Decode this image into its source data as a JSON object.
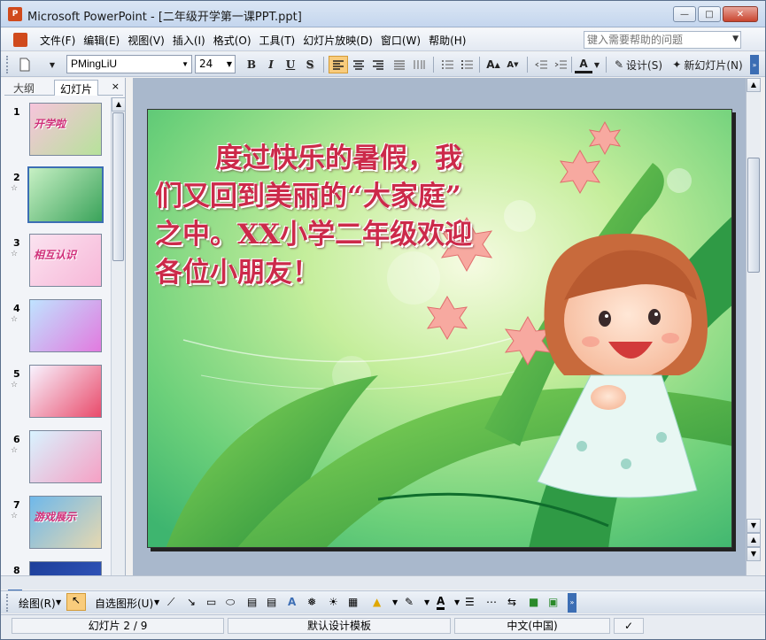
{
  "window": {
    "title": "Microsoft PowerPoint - [二年级开学第一课PPT.ppt]",
    "app_icon": "powerpoint-icon",
    "buttons": [
      "minimize",
      "maximize",
      "close"
    ]
  },
  "menubar": {
    "items": [
      "文件(F)",
      "编辑(E)",
      "视图(V)",
      "插入(I)",
      "格式(O)",
      "工具(T)",
      "幻灯片放映(D)",
      "窗口(W)",
      "帮助(H)"
    ],
    "help_placeholder": "键入需要帮助的问题"
  },
  "toolbar": {
    "font_name": "PMingLiU",
    "font_size": "24",
    "bold": "B",
    "italic": "I",
    "underline": "U",
    "shadow": "S",
    "design_label": "设计(S)",
    "new_slide_label": "新幻灯片(N)"
  },
  "panes": {
    "tab_outline": "大纲",
    "tab_slides": "幻灯片",
    "close_glyph": "×"
  },
  "thumbnails": [
    {
      "num": "1",
      "star": "",
      "colors": [
        "#f7c4dc",
        "#b6e29a"
      ],
      "caption": "开学啦"
    },
    {
      "num": "2",
      "star": "☆",
      "colors": [
        "#c7f0c4",
        "#3aa35a"
      ],
      "caption": ""
    },
    {
      "num": "3",
      "star": "☆",
      "colors": [
        "#fbe3f0",
        "#f7b7d8"
      ],
      "caption": "相互认识"
    },
    {
      "num": "4",
      "star": "☆",
      "colors": [
        "#bfe3ff",
        "#e27adf"
      ],
      "caption": ""
    },
    {
      "num": "5",
      "star": "☆",
      "colors": [
        "#f8f3ff",
        "#e94b6b"
      ],
      "caption": ""
    },
    {
      "num": "6",
      "star": "☆",
      "colors": [
        "#d8f3ff",
        "#f6a0c4"
      ],
      "caption": ""
    },
    {
      "num": "7",
      "star": "☆",
      "colors": [
        "#6fb8ea",
        "#e6d8b0"
      ],
      "caption": "游戏展示"
    },
    {
      "num": "8",
      "star": "",
      "colors": [
        "#1d3f9a",
        "#3559c2"
      ],
      "caption": ""
    }
  ],
  "selected_slide": 2,
  "slide": {
    "lines": [
      "度过快乐的暑假，我",
      "们又回到美丽的“大家庭”",
      "之中。XX小学二年级欢迎",
      "各位小朋友！"
    ]
  },
  "drawbar": {
    "draw_label": "绘图(R)",
    "autoshape_label": "自选图形(U)"
  },
  "statusbar": {
    "slide_info": "幻灯片 2 / 9",
    "template": "默认设计模板",
    "language": "中文(中国)"
  }
}
